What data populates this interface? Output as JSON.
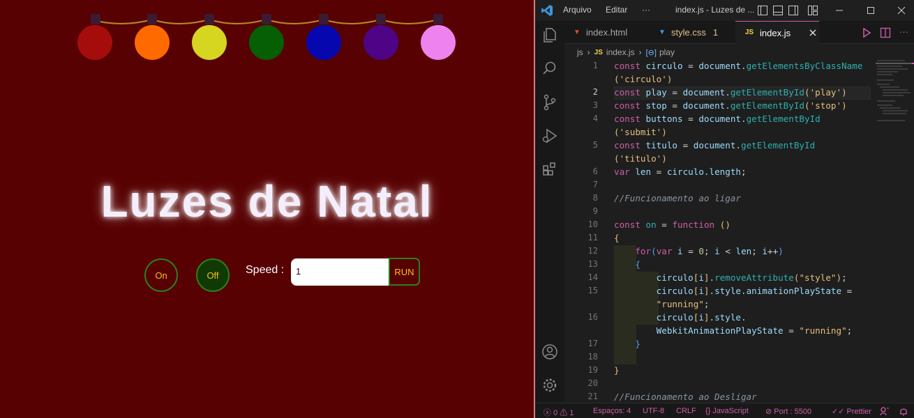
{
  "preview": {
    "title": "Luzes de Natal",
    "bulbs": [
      {
        "name": "red",
        "color": "#a50d0d"
      },
      {
        "name": "orange",
        "color": "#ff6a00"
      },
      {
        "name": "yellow",
        "color": "#d6d51f"
      },
      {
        "name": "green",
        "color": "#065e05"
      },
      {
        "name": "blue",
        "color": "#0707b0"
      },
      {
        "name": "purple",
        "color": "#4e0484"
      },
      {
        "name": "pink",
        "color": "#ee82ee"
      }
    ],
    "on_label": "On",
    "off_label": "Off",
    "speed_label": "Speed :",
    "speed_value": "1",
    "run_label": "RUN",
    "background": "#570102",
    "button_text_color": "#ffbe1f",
    "button_border_color": "#2f7e1c"
  },
  "vscode": {
    "menu": [
      "Arquivo",
      "Editar",
      "···"
    ],
    "window_title": "index.js - Luzes de ...",
    "tabs": [
      {
        "icon": "html5-icon",
        "label": "index.html",
        "badge": ""
      },
      {
        "icon": "css3-icon",
        "label": "style.css",
        "badge": "1"
      },
      {
        "icon": "js-icon",
        "icon_text": "JS",
        "label": "index.js",
        "badge": "",
        "active": true
      }
    ],
    "breadcrumb": {
      "folder": "js",
      "file_icon": "JS",
      "file": "index.js",
      "symbol": "play"
    },
    "line_numbers": [
      "1",
      "",
      "2",
      "3",
      "4",
      "",
      "5",
      "",
      "6",
      "7",
      "8",
      "9",
      "10",
      "11",
      "12",
      "13",
      "14",
      "15",
      "",
      "16",
      "",
      "17",
      "18",
      "19",
      "20",
      "21"
    ],
    "status": {
      "problems_errors": "0",
      "problems_warnings": "1",
      "spaces": "Espaços: 4",
      "encoding": "UTF-8",
      "eol": "CRLF",
      "language": "JavaScript",
      "port": "Port : 5500",
      "prettier": "Prettier"
    },
    "accent": "#cf5fa8"
  }
}
